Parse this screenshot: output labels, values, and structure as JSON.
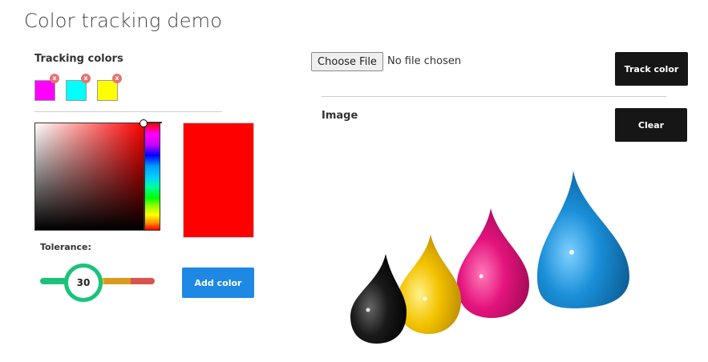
{
  "page": {
    "title": "Color tracking demo"
  },
  "tracking": {
    "title": "Tracking colors",
    "colors": [
      {
        "hex": "#ff00ff",
        "remove": "x"
      },
      {
        "hex": "#00ffff",
        "remove": "x"
      },
      {
        "hex": "#ffff00",
        "remove": "x"
      }
    ]
  },
  "picker": {
    "selected_color": "#ff0000"
  },
  "tolerance": {
    "label": "Tolerance:",
    "value": "30",
    "max": 100,
    "segment_colors": [
      "#19c47a",
      "#e8b820",
      "#d99a1e",
      "#d9534f"
    ]
  },
  "buttons": {
    "add_color": "Add color",
    "choose_file": "Choose File",
    "track_color": "Track color",
    "clear": "Clear"
  },
  "file": {
    "status": "No file chosen"
  },
  "image_section": {
    "title": "Image",
    "drops": [
      "#111111",
      "#f3c200",
      "#e4147d",
      "#1a8fd8"
    ]
  }
}
